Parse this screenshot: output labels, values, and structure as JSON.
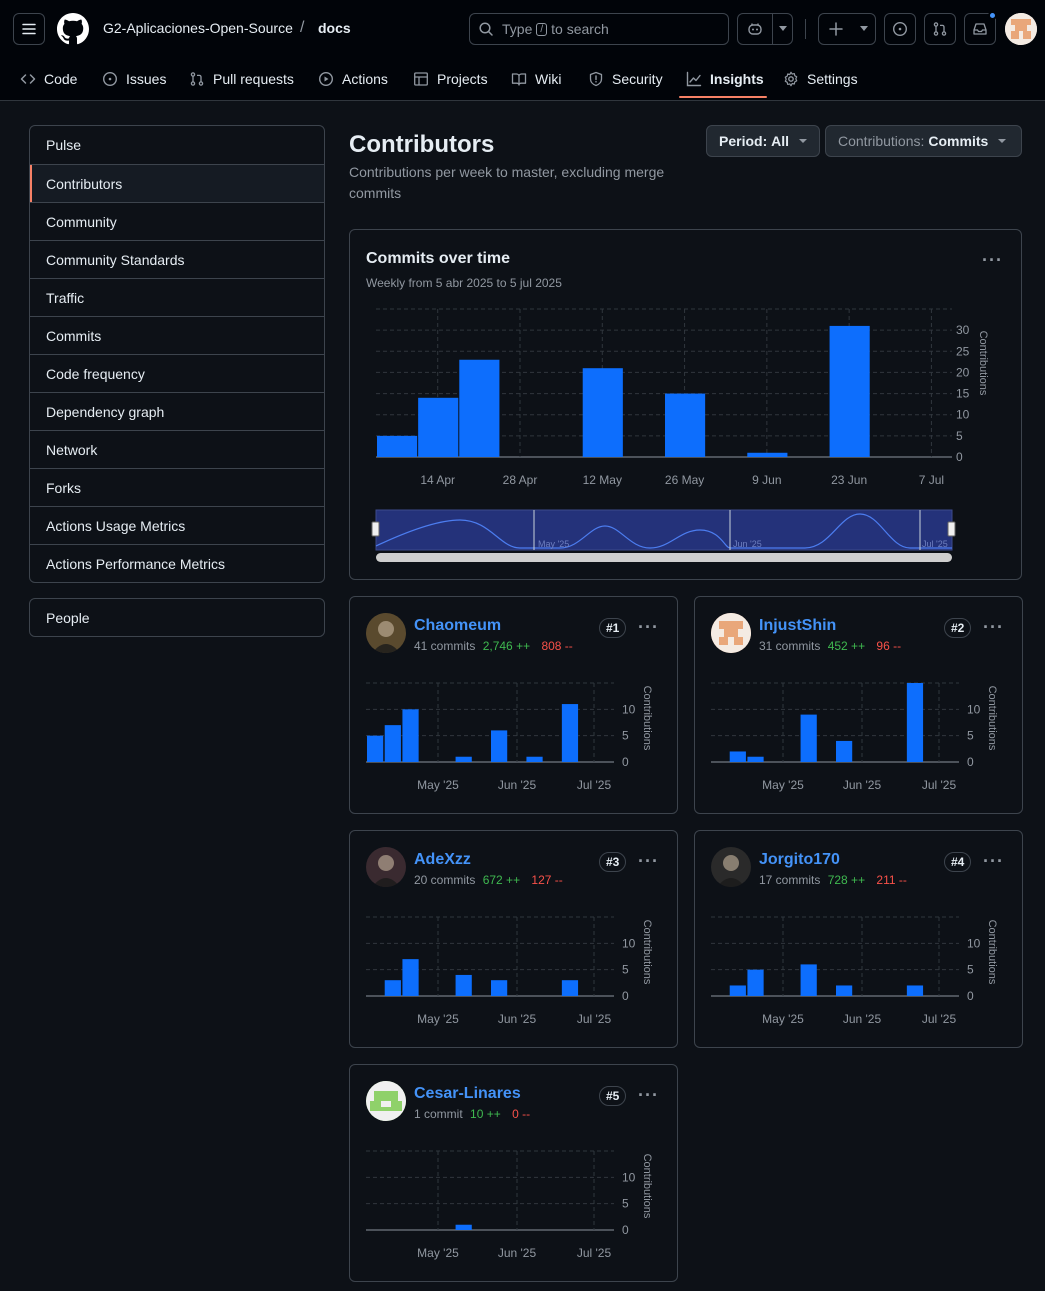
{
  "header": {
    "owner": "G2-Aplicaciones-Open-Source",
    "separator": "/",
    "repo": "docs",
    "search_prefix": "Type",
    "search_key": "/",
    "search_suffix": "to search"
  },
  "nav_tabs": [
    {
      "label": "Code",
      "icon": "code-icon"
    },
    {
      "label": "Issues",
      "icon": "issue-icon"
    },
    {
      "label": "Pull requests",
      "icon": "pull-request-icon"
    },
    {
      "label": "Actions",
      "icon": "play-icon"
    },
    {
      "label": "Projects",
      "icon": "table-icon"
    },
    {
      "label": "Wiki",
      "icon": "book-icon"
    },
    {
      "label": "Security",
      "icon": "shield-icon"
    },
    {
      "label": "Insights",
      "icon": "graph-icon",
      "selected": true
    },
    {
      "label": "Settings",
      "icon": "gear-icon"
    }
  ],
  "sidebar": {
    "items": [
      "Pulse",
      "Contributors",
      "Community",
      "Community Standards",
      "Traffic",
      "Commits",
      "Code frequency",
      "Dependency graph",
      "Network",
      "Forks",
      "Actions Usage Metrics",
      "Actions Performance Metrics"
    ],
    "active_index": 1,
    "secondary": "People"
  },
  "page": {
    "title": "Contributors",
    "subtitle": "Contributions per week to master, excluding merge commits",
    "period_label": "Period:",
    "period_value": "All",
    "contributions_label": "Contributions:",
    "contributions_value": "Commits"
  },
  "overview": {
    "title": "Commits over time",
    "subtitle": "Weekly from 5 abr 2025 to 5 jul 2025",
    "range_labels": [
      "May '25",
      "Jun '25",
      "Jul '25"
    ]
  },
  "chart_data": [
    {
      "type": "bar",
      "title": "Commits over time",
      "ylabel": "Contributions",
      "ylim": [
        0,
        30
      ],
      "yticks": [
        0,
        5,
        10,
        15,
        20,
        25,
        30
      ],
      "xticks": [
        "14 Apr",
        "28 Apr",
        "12 May",
        "26 May",
        "9 Jun",
        "23 Jun",
        "7 Jul"
      ],
      "x": [
        "2025-04-05",
        "2025-04-12",
        "2025-04-19",
        "2025-04-26",
        "2025-05-03",
        "2025-05-10",
        "2025-05-17",
        "2025-05-24",
        "2025-05-31",
        "2025-06-07",
        "2025-06-14",
        "2025-06-21",
        "2025-06-28"
      ],
      "values": [
        5,
        14,
        23,
        0,
        0,
        21,
        0,
        15,
        0,
        1,
        0,
        31,
        0
      ],
      "grid": true,
      "color": "#0d6efd"
    },
    {
      "type": "bar",
      "contributor": "Chaomeum",
      "ylabel": "Contributions",
      "ylim": [
        0,
        15
      ],
      "yticks": [
        0,
        5,
        10
      ],
      "xticks": [
        "May '25",
        "Jun '25",
        "Jul '25"
      ],
      "values": [
        5,
        7,
        10,
        0,
        0,
        1,
        0,
        6,
        0,
        1,
        0,
        11,
        0
      ]
    },
    {
      "type": "bar",
      "contributor": "InjustShin",
      "ylabel": "Contributions",
      "ylim": [
        0,
        15
      ],
      "yticks": [
        0,
        5,
        10
      ],
      "xticks": [
        "May '25",
        "Jun '25",
        "Jul '25"
      ],
      "values": [
        0,
        2,
        1,
        0,
        0,
        9,
        0,
        4,
        0,
        0,
        0,
        15,
        0
      ]
    },
    {
      "type": "bar",
      "contributor": "AdeXzz",
      "ylabel": "Contributions",
      "ylim": [
        0,
        15
      ],
      "yticks": [
        0,
        5,
        10
      ],
      "xticks": [
        "May '25",
        "Jun '25",
        "Jul '25"
      ],
      "values": [
        0,
        3,
        7,
        0,
        0,
        4,
        0,
        3,
        0,
        0,
        0,
        3,
        0
      ]
    },
    {
      "type": "bar",
      "contributor": "Jorgito170",
      "ylabel": "Contributions",
      "ylim": [
        0,
        15
      ],
      "yticks": [
        0,
        5,
        10
      ],
      "xticks": [
        "May '25",
        "Jun '25",
        "Jul '25"
      ],
      "values": [
        0,
        2,
        5,
        0,
        0,
        6,
        0,
        2,
        0,
        0,
        0,
        2,
        0
      ]
    },
    {
      "type": "bar",
      "contributor": "Cesar-Linares",
      "ylabel": "Contributions",
      "ylim": [
        0,
        15
      ],
      "yticks": [
        0,
        5,
        10
      ],
      "xticks": [
        "May '25",
        "Jun '25",
        "Jul '25"
      ],
      "values": [
        0,
        0,
        0,
        0,
        0,
        1,
        0,
        0,
        0,
        0,
        0,
        0,
        0
      ]
    }
  ],
  "contributors": [
    {
      "name": "Chaomeum",
      "commits": "41 commits",
      "additions": "2,746 ++",
      "deletions": "808 --",
      "rank": "#1",
      "avatar_color": "#5a4a2e"
    },
    {
      "name": "InjustShin",
      "commits": "31 commits",
      "additions": "452 ++",
      "deletions": "96 --",
      "rank": "#2",
      "avatar_color": "#e9a77a"
    },
    {
      "name": "AdeXzz",
      "commits": "20 commits",
      "additions": "672 ++",
      "deletions": "127 --",
      "rank": "#3",
      "avatar_color": "#3a2a30"
    },
    {
      "name": "Jorgito170",
      "commits": "17 commits",
      "additions": "728 ++",
      "deletions": "211 --",
      "rank": "#4",
      "avatar_color": "#2a2a2a"
    },
    {
      "name": "Cesar-Linares",
      "commits": "1 commit",
      "additions": "10 ++",
      "deletions": "0 --",
      "rank": "#5",
      "avatar_color": "#8fd16a"
    }
  ]
}
